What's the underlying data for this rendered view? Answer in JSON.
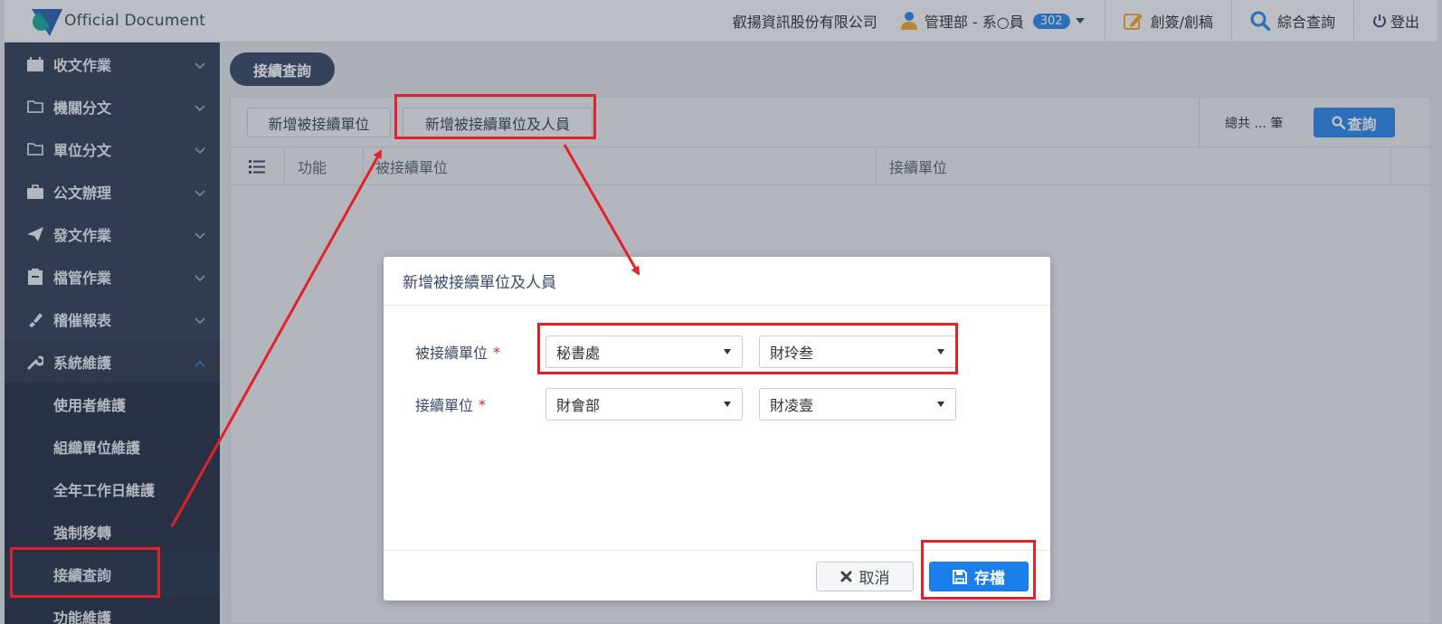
{
  "app": {
    "logo_text": "Official Document"
  },
  "header": {
    "company": "叡揚資訊股份有限公司",
    "user": "管理部 - 系○員",
    "badge": "302",
    "compose": "創簽/創稿",
    "search": "綜合查詢",
    "logout": "登出"
  },
  "sidebar": {
    "items": [
      {
        "label": "收文作業",
        "icon": "calendar-icon"
      },
      {
        "label": "機關分文",
        "icon": "folder-icon"
      },
      {
        "label": "單位分文",
        "icon": "folder-icon"
      },
      {
        "label": "公文辦理",
        "icon": "briefcase-icon"
      },
      {
        "label": "發文作業",
        "icon": "send-icon"
      },
      {
        "label": "檔管作業",
        "icon": "archive-icon"
      },
      {
        "label": "稽催報表",
        "icon": "stamp-icon"
      },
      {
        "label": "系統維護",
        "icon": "wrench-icon"
      }
    ],
    "subitems": [
      "使用者維護",
      "組織單位維護",
      "全年工作日維護",
      "強制移轉",
      "接續查詢",
      "功能維護"
    ]
  },
  "main": {
    "page_pill": "接續查詢",
    "add_unit_button": "新增被接續單位",
    "add_unit_person_button": "新增被接續單位及人員",
    "total": "總共 ... 筆",
    "query_button": "查詢",
    "columns": [
      "功能",
      "被接續單位",
      "接續單位"
    ]
  },
  "modal": {
    "title": "新增被接續單位及人員",
    "rows": [
      {
        "label": "被接續單位",
        "unit": "秘書處",
        "person": "財玲叁"
      },
      {
        "label": "接續單位",
        "unit": "財會部",
        "person": "財凌壹"
      }
    ],
    "required_mark": "*",
    "cancel": "取消",
    "save": "存檔"
  },
  "colors": {
    "accent": "#2f87e6",
    "sidebar": "#35405a",
    "annotation": "#e3212a"
  }
}
